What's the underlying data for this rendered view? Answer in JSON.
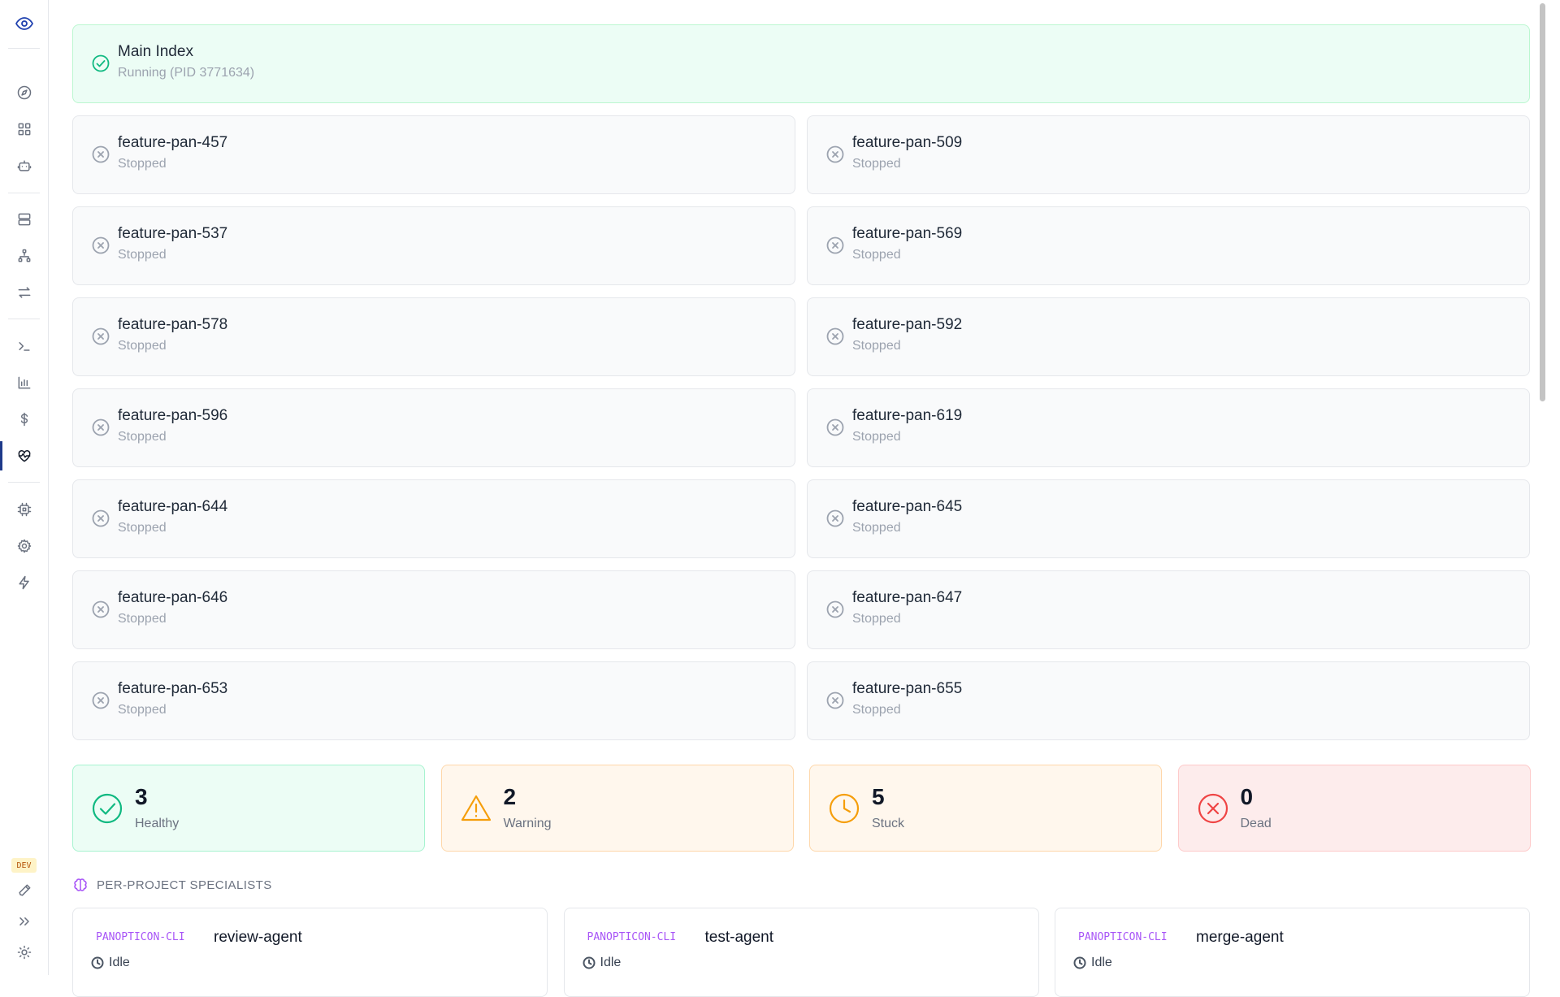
{
  "sidebar": {
    "dev_badge": "DEV",
    "items": [
      {
        "icon": "eye-icon"
      },
      {
        "icon": "compass-icon"
      },
      {
        "icon": "grid-icon"
      },
      {
        "icon": "bot-icon"
      },
      {
        "icon": "server-icon"
      },
      {
        "icon": "network-icon"
      },
      {
        "icon": "arrows-swap-icon"
      },
      {
        "icon": "terminal-icon"
      },
      {
        "icon": "bar-chart-icon"
      },
      {
        "icon": "dollar-icon"
      },
      {
        "icon": "heart-pulse-icon",
        "active": true
      },
      {
        "icon": "cpu-icon"
      },
      {
        "icon": "gear-icon"
      },
      {
        "icon": "bolt-icon"
      },
      {
        "icon": "hammer-icon"
      },
      {
        "icon": "chevrons-right-icon"
      },
      {
        "icon": "sun-icon"
      }
    ]
  },
  "main_index": {
    "name": "Main Index",
    "status": "Running (PID 3771634)"
  },
  "workspaces": [
    {
      "name": "feature-pan-457",
      "status": "Stopped"
    },
    {
      "name": "feature-pan-509",
      "status": "Stopped"
    },
    {
      "name": "feature-pan-537",
      "status": "Stopped"
    },
    {
      "name": "feature-pan-569",
      "status": "Stopped"
    },
    {
      "name": "feature-pan-578",
      "status": "Stopped"
    },
    {
      "name": "feature-pan-592",
      "status": "Stopped"
    },
    {
      "name": "feature-pan-596",
      "status": "Stopped"
    },
    {
      "name": "feature-pan-619",
      "status": "Stopped"
    },
    {
      "name": "feature-pan-644",
      "status": "Stopped"
    },
    {
      "name": "feature-pan-645",
      "status": "Stopped"
    },
    {
      "name": "feature-pan-646",
      "status": "Stopped"
    },
    {
      "name": "feature-pan-647",
      "status": "Stopped"
    },
    {
      "name": "feature-pan-653",
      "status": "Stopped"
    },
    {
      "name": "feature-pan-655",
      "status": "Stopped"
    }
  ],
  "stats": [
    {
      "value": "3",
      "label": "Healthy",
      "bg": "#ecfdf5",
      "border": "#a7f3d0",
      "color": "#10b981",
      "icon": "check-circle-icon"
    },
    {
      "value": "2",
      "label": "Warning",
      "bg": "#fff7ed",
      "border": "#fed7aa",
      "color": "#f59e0b",
      "icon": "warning-triangle-icon"
    },
    {
      "value": "5",
      "label": "Stuck",
      "bg": "#fff7ed",
      "border": "#fed7aa",
      "color": "#f59e0b",
      "icon": "clock-icon"
    },
    {
      "value": "0",
      "label": "Dead",
      "bg": "#fdecec",
      "border": "#fecaca",
      "color": "#ef4444",
      "icon": "x-circle-icon"
    }
  ],
  "specialists": {
    "title": "PER-PROJECT SPECIALISTS",
    "items": [
      {
        "project": "PANOPTICON-CLI",
        "name": "review-agent",
        "status": "Idle"
      },
      {
        "project": "PANOPTICON-CLI",
        "name": "test-agent",
        "status": "Idle"
      },
      {
        "project": "PANOPTICON-CLI",
        "name": "merge-agent",
        "status": "Idle"
      }
    ]
  }
}
